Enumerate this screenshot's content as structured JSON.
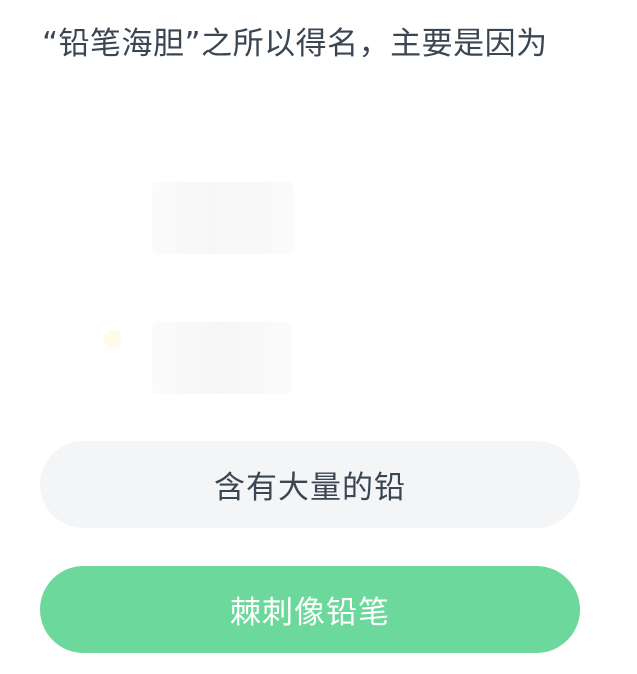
{
  "question": {
    "text": "“铅笔海胆”之所以得名，主要是因为"
  },
  "options": [
    {
      "label": "含有大量的铅",
      "state": "default"
    },
    {
      "label": "棘刺像铅笔",
      "state": "selected-correct"
    }
  ],
  "colors": {
    "question_text": "#3b4653",
    "option_default_bg": "#f4f5f7",
    "option_selected_bg": "#6cd89b",
    "option_selected_text": "#ffffff"
  }
}
